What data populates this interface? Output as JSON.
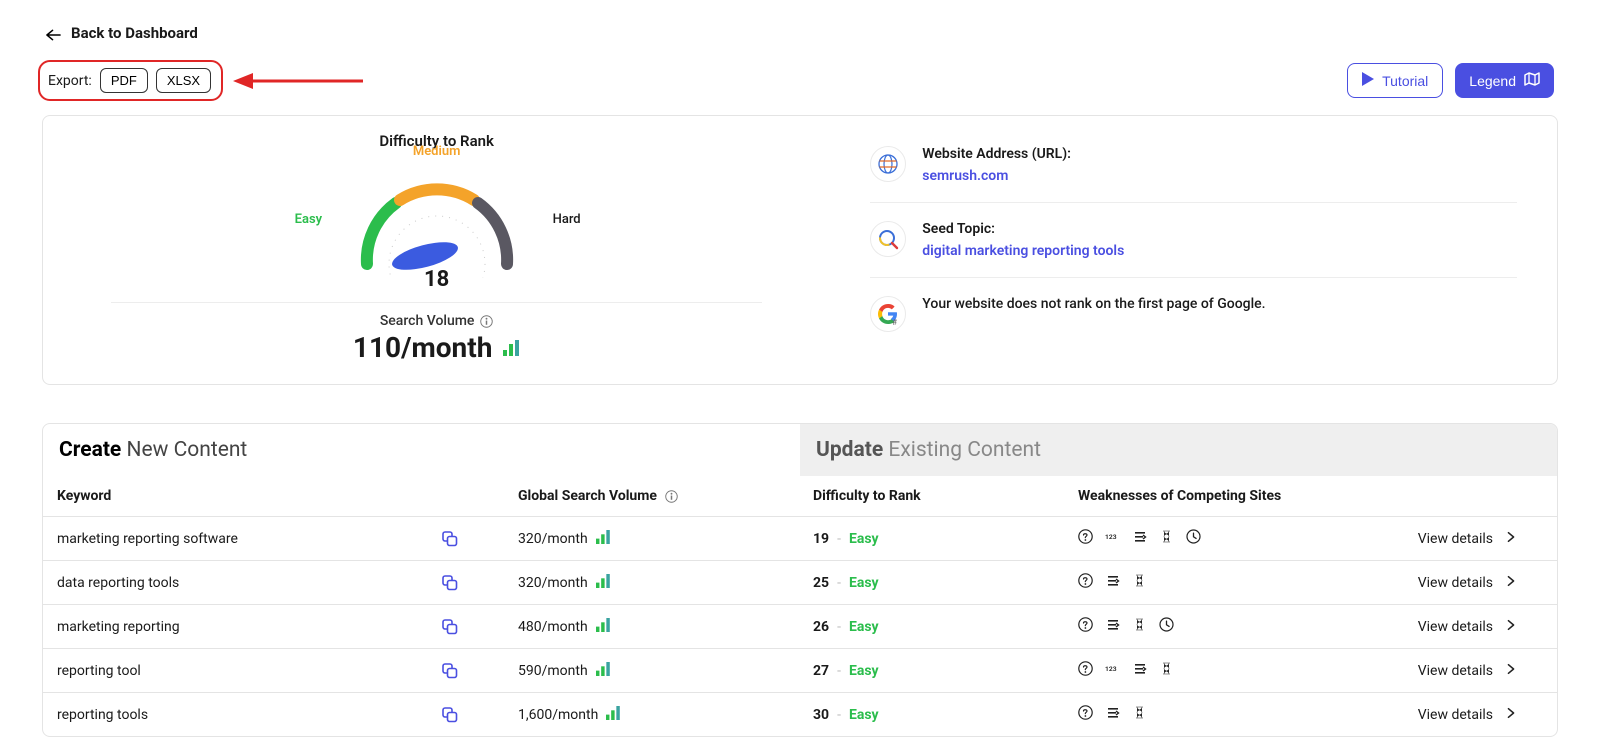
{
  "back_link": "Back to Dashboard",
  "export": {
    "label": "Export:",
    "pdf": "PDF",
    "xlsx": "XLSX"
  },
  "tutorial_label": "Tutorial",
  "legend_label": "Legend",
  "difficulty": {
    "title": "Difficulty to Rank",
    "easy": "Easy",
    "medium": "Medium",
    "hard": "Hard",
    "score": "18"
  },
  "search_volume": {
    "title": "Search Volume",
    "value": "110/month"
  },
  "info": {
    "url_label": "Website Address (URL):",
    "url_value": "semrush.com",
    "seed_label": "Seed Topic:",
    "seed_value": "digital marketing reporting tools",
    "rank_text": "Your website does not rank on the first page of Google."
  },
  "tabs": {
    "create_strong": "Create",
    "create_rest": " New Content",
    "update_strong": "Update",
    "update_rest": " Existing Content"
  },
  "columns": {
    "kw": "Keyword",
    "gsv": "Global Search Volume",
    "diff": "Difficulty to Rank",
    "weak": "Weaknesses of Competing Sites"
  },
  "view_details": "View details",
  "rows": [
    {
      "kw": "marketing reporting software",
      "gsv": "320/month",
      "diff": "19",
      "ease": "Easy",
      "weak": [
        "question",
        "num123",
        "list",
        "hourglass",
        "clock"
      ]
    },
    {
      "kw": "data reporting tools",
      "gsv": "320/month",
      "diff": "25",
      "ease": "Easy",
      "weak": [
        "question",
        "list",
        "hourglass"
      ]
    },
    {
      "kw": "marketing reporting",
      "gsv": "480/month",
      "diff": "26",
      "ease": "Easy",
      "weak": [
        "question",
        "list",
        "hourglass",
        "clock"
      ]
    },
    {
      "kw": "reporting tool",
      "gsv": "590/month",
      "diff": "27",
      "ease": "Easy",
      "weak": [
        "question",
        "num123",
        "list",
        "hourglass"
      ]
    },
    {
      "kw": "reporting tools",
      "gsv": "1,600/month",
      "diff": "30",
      "ease": "Easy",
      "weak": [
        "question",
        "list",
        "hourglass"
      ]
    }
  ]
}
